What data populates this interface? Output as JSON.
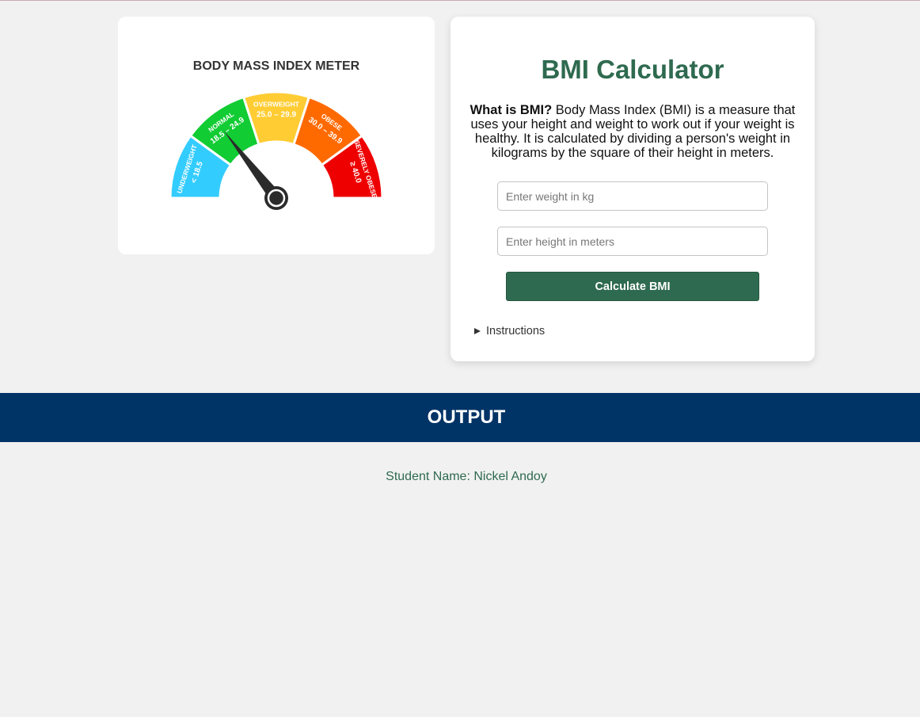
{
  "meter": {
    "title": "BODY MASS INDEX METER",
    "segments": [
      {
        "label": "UNDERWEIGHT",
        "range": "< 18.5",
        "color": "#33ccff"
      },
      {
        "label": "NORMAL",
        "range": "18.5 – 24.9",
        "color": "#11cc33"
      },
      {
        "label": "OVERWEIGHT",
        "range": "25.0 – 29.9",
        "color": "#ffcc33"
      },
      {
        "label": "OBESE",
        "range": "30.0 – 39.9",
        "color": "#ff6a00"
      },
      {
        "label": "SEVERELY OBESE",
        "range": "≥ 40.0",
        "color": "#ee0000"
      }
    ],
    "needle_color": "#2b2b2b"
  },
  "calculator": {
    "title": "BMI Calculator",
    "desc_bold": "What is BMI?",
    "desc_text": " Body Mass Index (BMI) is a measure that uses your height and weight to work out if your weight is healthy. It is calculated by dividing a person's weight in kilograms by the square of their height in meters.",
    "weight_placeholder": "Enter weight in kg",
    "weight_value": "",
    "height_placeholder": "Enter height in meters",
    "height_value": "",
    "button_label": "Calculate BMI",
    "instructions_label": "Instructions"
  },
  "output": {
    "title": "OUTPUT",
    "student_line": "Student Name: Nickel Andoy"
  },
  "colors": {
    "accent_green": "#2e6a4f",
    "output_blue": "#003366",
    "background": "#f1f1f1"
  }
}
